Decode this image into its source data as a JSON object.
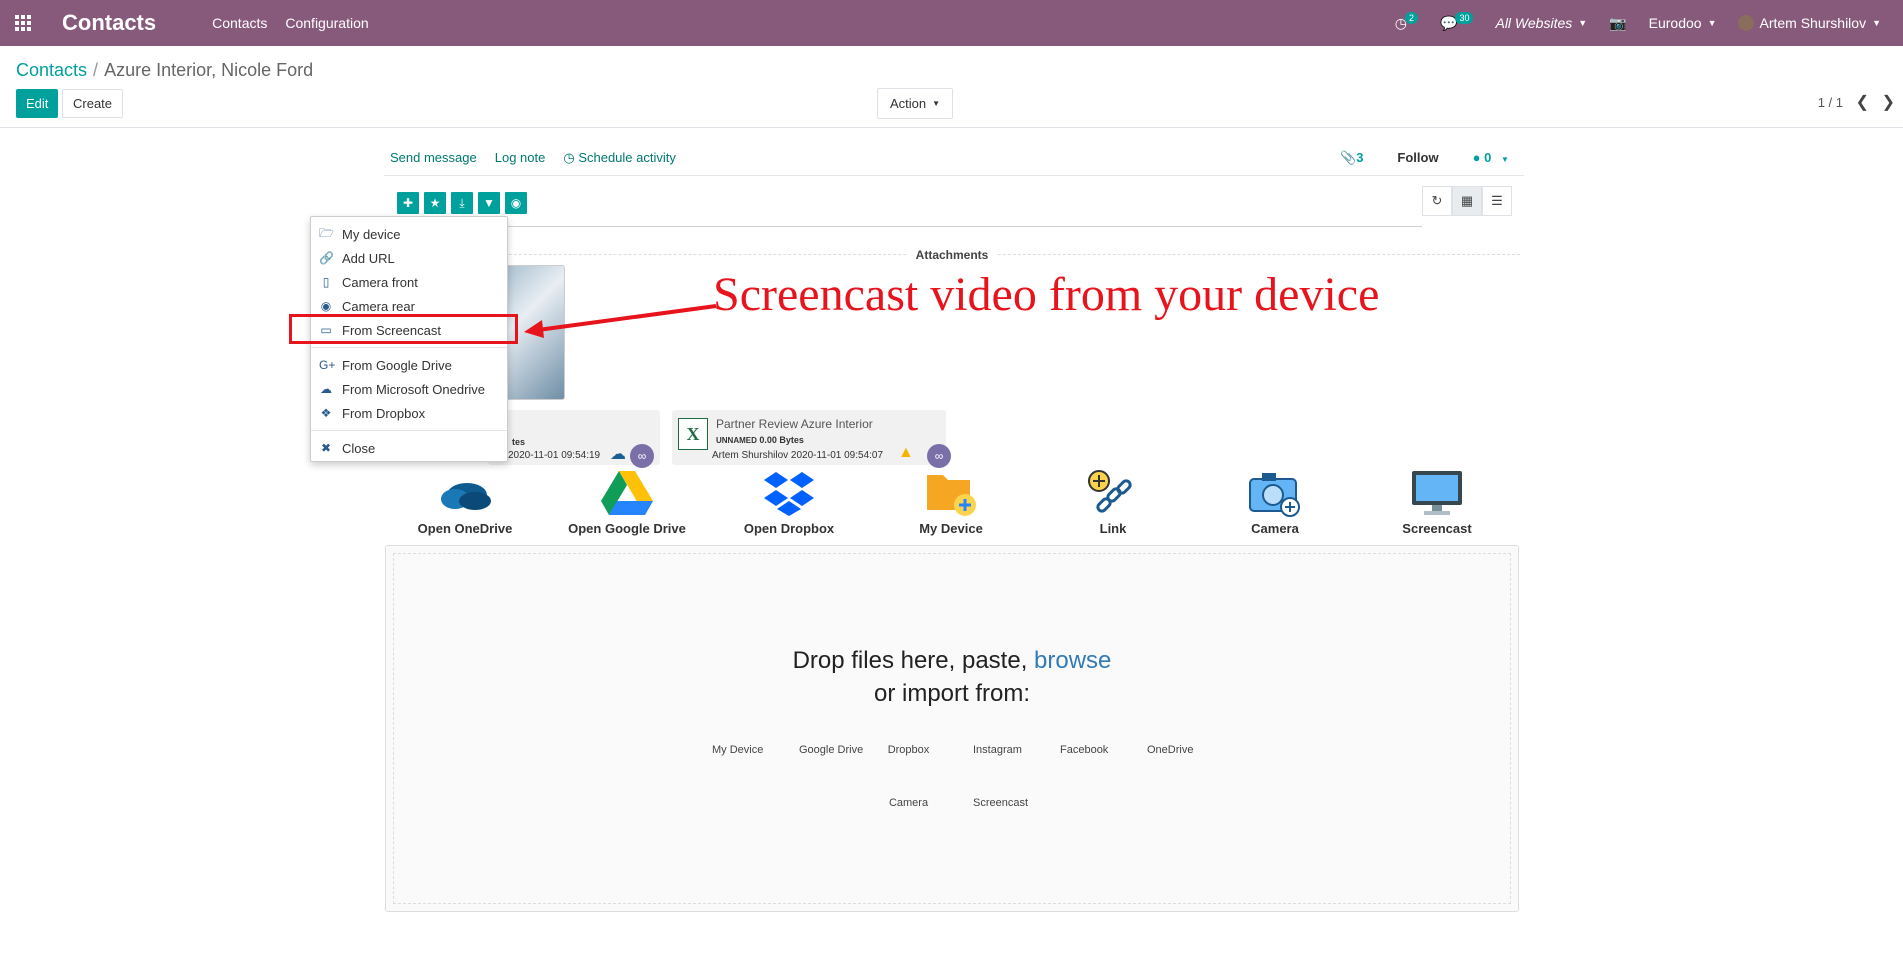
{
  "navbar": {
    "brand": "Contacts",
    "menu": [
      "Contacts",
      "Configuration"
    ],
    "activity_count": "2",
    "message_count": "30",
    "website": "All Websites",
    "company": "Eurodoo",
    "user": "Artem Shurshilov"
  },
  "breadcrumb": {
    "root": "Contacts",
    "current": "Azure Interior, Nicole Ford"
  },
  "buttons": {
    "edit": "Edit",
    "create": "Create",
    "action": "Action"
  },
  "pager": "1 / 1",
  "chatter": {
    "send_message": "Send message",
    "log_note": "Log note",
    "schedule_activity": "Schedule activity",
    "attachment_count": "3",
    "follow": "Follow",
    "followers": "0"
  },
  "attachments_title": "Attachments",
  "dropdown_items": [
    {
      "label": "My device",
      "icon": "folder-open-icon"
    },
    {
      "label": "Add URL",
      "icon": "link-icon"
    },
    {
      "label": "Camera front",
      "icon": "mobile-icon"
    },
    {
      "label": "Camera rear",
      "icon": "camera-icon"
    },
    {
      "label": "From Screencast",
      "icon": "desktop-icon"
    },
    {
      "label": "From Google Drive",
      "icon": "google-plus-icon"
    },
    {
      "label": "From Microsoft Onedrive",
      "icon": "cloud-icon"
    },
    {
      "label": "From Dropbox",
      "icon": "dropbox-icon"
    },
    {
      "label": "Close",
      "icon": "close-icon"
    }
  ],
  "thumb_card": {
    "size_fragment": "tes",
    "date": "2020-11-01 09:54:19"
  },
  "file_card": {
    "name": "Partner Review Azure Interior",
    "size_prefix": "UNNAMED",
    "size": "0.00 Bytes",
    "meta": "Artem Shurshilov 2020-11-01 09:54:07"
  },
  "sources": [
    "Open OneDrive",
    "Open Google Drive",
    "Open Dropbox",
    "My Device",
    "Link",
    "Camera",
    "Screencast"
  ],
  "drop_zone": {
    "line1": "Drop files here, paste, ",
    "browse": "browse",
    "line2": "or import from:",
    "import_row1": [
      "My Device",
      "Google Drive",
      "Dropbox",
      "Instagram",
      "Facebook",
      "OneDrive"
    ],
    "import_row2": [
      "Camera",
      "Screencast"
    ]
  },
  "annotation": "Screencast video from your device",
  "colors": {
    "navbar": "#875a7b",
    "primary": "#00a09d",
    "annotation": "#e8141d"
  }
}
